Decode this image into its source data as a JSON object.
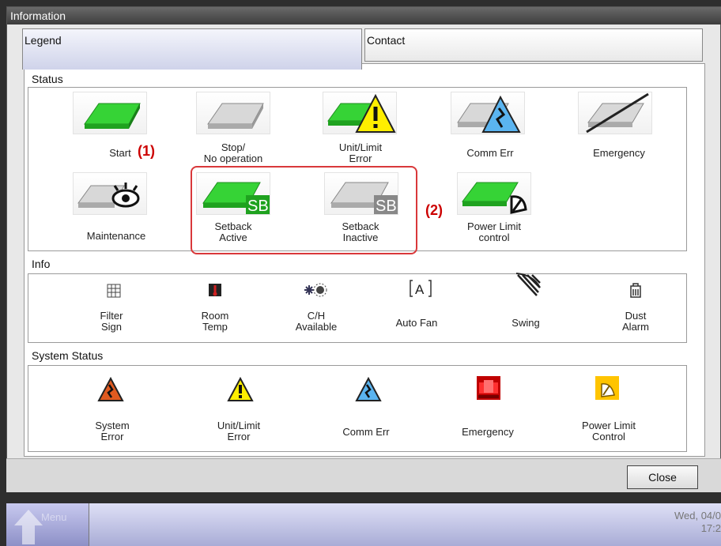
{
  "window": {
    "title": "Information"
  },
  "tabs": [
    {
      "label": "Legend"
    },
    {
      "label": "Contact"
    }
  ],
  "status": {
    "title": "Status",
    "items": [
      {
        "label": "Start",
        "icon": "start-icon"
      },
      {
        "label": "Stop/\nNo operation",
        "icon": "stop-icon"
      },
      {
        "label": "Unit/Limit\nError",
        "icon": "unit-limit-error-icon"
      },
      {
        "label": "Comm Err",
        "icon": "comm-err-icon"
      },
      {
        "label": "Emergency",
        "icon": "emergency-icon"
      },
      {
        "label": "Maintenance",
        "icon": "maintenance-icon"
      },
      {
        "label": "Setback\nActive",
        "icon": "setback-active-icon"
      },
      {
        "label": "Setback\nInactive",
        "icon": "setback-inactive-icon"
      },
      {
        "label": "Power Limit\ncontrol",
        "icon": "power-limit-control-icon"
      }
    ]
  },
  "info": {
    "title": "Info",
    "items": [
      {
        "label": "Filter\nSign",
        "icon": "filter-sign-icon"
      },
      {
        "label": "Room\nTemp",
        "icon": "room-temp-icon"
      },
      {
        "label": "C/H\nAvailable",
        "icon": "ch-available-icon"
      },
      {
        "label": "Auto Fan",
        "icon": "auto-fan-icon"
      },
      {
        "label": "Swing",
        "icon": "swing-icon"
      },
      {
        "label": "Dust\nAlarm",
        "icon": "dust-alarm-icon"
      }
    ]
  },
  "system_status": {
    "title": "System Status",
    "items": [
      {
        "label": "System\nError",
        "icon": "system-error-icon"
      },
      {
        "label": "Unit/Limit\nError",
        "icon": "unit-limit-warning-icon"
      },
      {
        "label": "Comm Err",
        "icon": "comm-err-icon"
      },
      {
        "label": "Emergency",
        "icon": "emergency-icon"
      },
      {
        "label": "Power Limit\nControl",
        "icon": "power-limit-icon"
      }
    ]
  },
  "annotations": {
    "callout1": "(1)",
    "callout2": "(2)"
  },
  "footer": {
    "close_label": "Close"
  },
  "taskbar": {
    "menu_label": "Menu",
    "date": "Wed, 04/0",
    "time": "17:2"
  },
  "icon_text": {
    "setback": "SB",
    "auto_fan": "A"
  },
  "colors": {
    "accent_green": "#33cc33",
    "highlight": "#d9383a",
    "callout": "#cc0000",
    "warning_yellow": "#ffee00",
    "error_orange": "#e05a20",
    "comm_blue": "#5ab4f0"
  }
}
